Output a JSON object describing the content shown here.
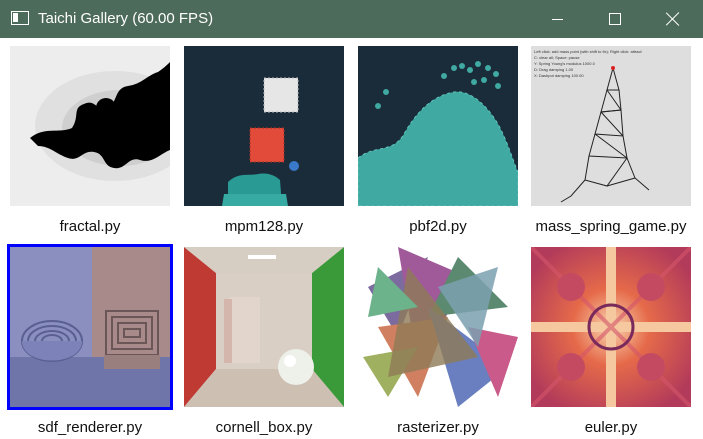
{
  "window": {
    "title": "Taichi Gallery (60.00 FPS)",
    "controls": [
      "minimize-icon",
      "maximize-icon",
      "close-icon"
    ]
  },
  "gallery": {
    "items": [
      {
        "label": "fractal.py"
      },
      {
        "label": "mpm128.py"
      },
      {
        "label": "pbf2d.py"
      },
      {
        "label": "mass_spring_game.py"
      },
      {
        "label": "sdf_renderer.py",
        "selected": true
      },
      {
        "label": "cornell_box.py"
      },
      {
        "label": "rasterizer.py"
      },
      {
        "label": "euler.py"
      }
    ],
    "mass_spring_overlay": [
      "Left click: add mass point (with shift to fix); Right click: attract",
      "C: clear all; Space: pause",
      "Y: Spring Young's modulus 1000.0",
      "D: Drag damping 1.00",
      "X: Dashpot damping 100.00"
    ]
  },
  "colors": {
    "titlebar": "#4d6b5a",
    "selection": "#0000ff"
  }
}
